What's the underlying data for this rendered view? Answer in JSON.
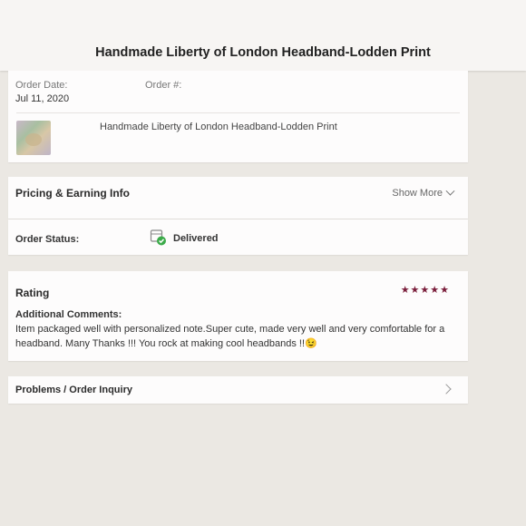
{
  "header": {
    "title": "Handmade Liberty of London Headband-Lodden Print"
  },
  "order": {
    "date_label": "Order Date:",
    "date_value": "Jul 11, 2020",
    "number_label": "Order #:",
    "item_name": "Handmade Liberty of London Headband-Lodden Print"
  },
  "pricing": {
    "title": "Pricing & Earning Info",
    "show_more": "Show More"
  },
  "status": {
    "label": "Order Status:",
    "value": "Delivered",
    "color": "#3cab4a"
  },
  "rating": {
    "title": "Rating",
    "stars": "★★★★★",
    "star_count": 5,
    "star_color": "#7a1d3a",
    "comments_label": "Additional Comments:",
    "comments_text": "Item packaged well with personalized note.Super cute, made very well and very comfortable for a headband. Many Thanks !!! You rock at making cool headbands !!😉"
  },
  "problems": {
    "label": "Problems / Order Inquiry"
  }
}
